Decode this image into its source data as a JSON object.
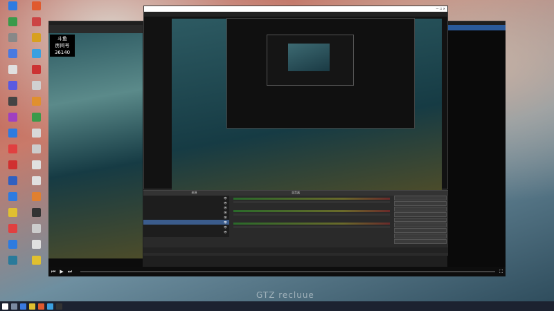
{
  "desktop": {
    "icons": [
      "",
      "",
      "",
      "",
      "",
      "",
      "",
      "",
      "",
      "",
      "",
      "",
      "",
      "",
      "",
      "",
      "",
      "",
      "",
      "",
      "",
      "",
      "",
      "",
      "",
      "",
      "",
      "",
      "",
      "",
      "",
      "",
      "",
      ""
    ],
    "icon_colors": [
      "#2e7be0",
      "#e05a2e",
      "#3a9a4a",
      "#c44",
      "#888",
      "#d8a020",
      "#4a7ae0",
      "#3aa0e0",
      "#e0e0e0",
      "#c33",
      "#5a5ae0",
      "#d0d0d0",
      "#444",
      "#e0902e",
      "#a040c0",
      "#3a9a4a",
      "#2e7be0",
      "#d8d8d8",
      "#e04040",
      "#ccc",
      "#d03030",
      "#e0e0e0",
      "#3060c0",
      "#e0e0e0",
      "#2e7be0",
      "#e08030",
      "#e0c030",
      "#333",
      "#e04040",
      "#ccc",
      "#2e7be0",
      "#e0e0e0",
      "#2a7a9a",
      "#e0c030"
    ]
  },
  "scene": {
    "title": "",
    "logo_top": "斗鱼",
    "logo_mid": "房间号",
    "room_number": "36140"
  },
  "right_pane": {
    "rows": [
      {
        "name": "",
        "time": ""
      },
      {
        "name": "",
        "time": ""
      },
      {
        "name": "",
        "time": ""
      },
      {
        "name": "",
        "time": ""
      }
    ]
  },
  "obs": {
    "title": "",
    "menu": "",
    "dock_headers": [
      "来源",
      "混音器",
      ""
    ],
    "sources": [
      "",
      "",
      "",
      "",
      "",
      "",
      "",
      ""
    ],
    "mixer": [
      {
        "name": "",
        "db": ""
      },
      {
        "name": "",
        "db": ""
      },
      {
        "name": "",
        "db": ""
      }
    ],
    "controls": [
      "",
      "",
      "",
      "",
      "",
      "",
      "",
      "",
      ""
    ],
    "status": [
      "",
      "",
      "",
      ""
    ]
  },
  "player": {
    "time": ""
  },
  "watermark": "GTZ recluue",
  "tray": {
    "time": "",
    "date": ""
  }
}
